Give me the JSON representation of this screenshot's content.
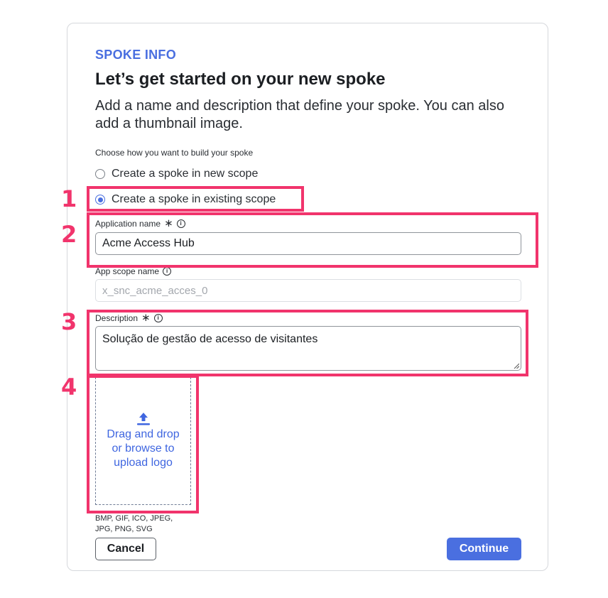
{
  "form": {
    "eyebrow": "SPOKE INFO",
    "title": "Let’s get started on your new spoke",
    "subtitle": "Add a name and description that define your spoke. You can also add a thumbnail image.",
    "build_prompt": "Choose how you want to build your spoke",
    "options": [
      {
        "label": "Create a spoke in new scope",
        "selected": false
      },
      {
        "label": "Create a spoke in existing scope",
        "selected": true
      }
    ],
    "app_name": {
      "label": "Application name",
      "required_mark": "∗",
      "value": "Acme Access Hub"
    },
    "app_scope": {
      "label": "App scope name",
      "placeholder": "x_snc_acme_acces_0"
    },
    "description": {
      "label": "Description",
      "required_mark": "∗",
      "value": "Solução de gestão de acesso de visitantes"
    },
    "upload": {
      "text": "Drag and drop or browse to upload logo",
      "icon": "upload-icon"
    },
    "formats": "BMP, GIF, ICO, JPEG, JPG, PNG, SVG",
    "cancel_label": "Cancel",
    "continue_label": "Continue",
    "info_glyph": "i"
  },
  "annotations": [
    "1",
    "2",
    "3",
    "4"
  ],
  "colors": {
    "accent": "#4a6fe0",
    "highlight": "#f1346c"
  }
}
